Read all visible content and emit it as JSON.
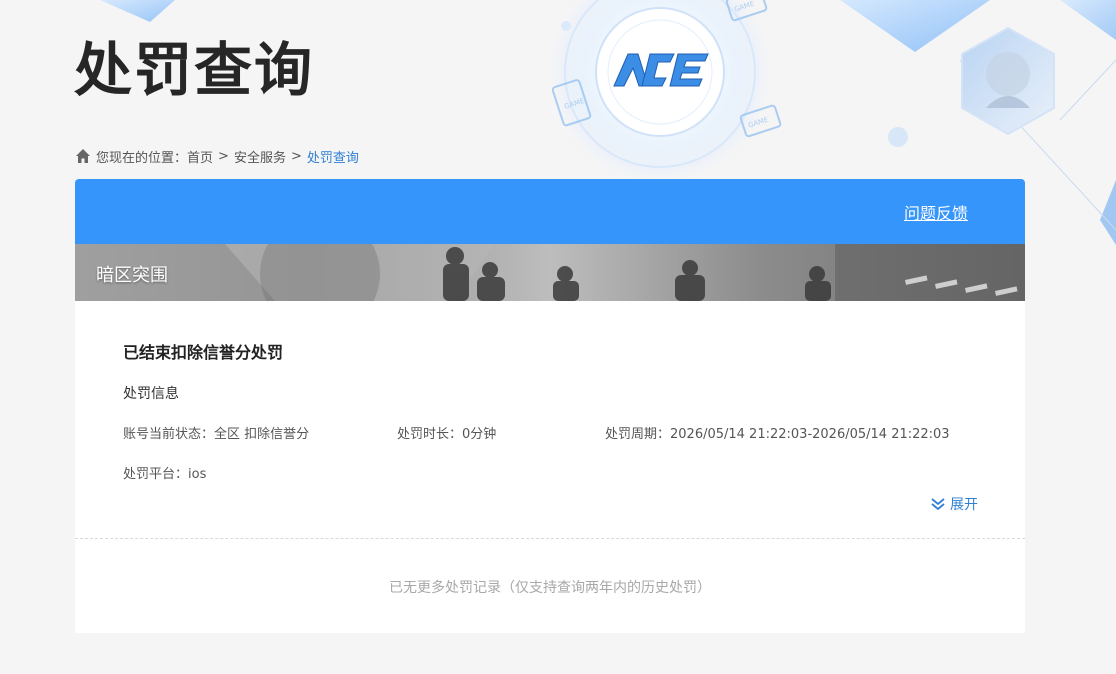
{
  "header": {
    "title": "处罚查询",
    "logo_text": "ACE",
    "game_badge": "GAME"
  },
  "breadcrumb": {
    "prefix": "您现在的位置：",
    "home": "首页",
    "separator": ">",
    "section": "安全服务",
    "current": "处罚查询"
  },
  "panel": {
    "feedback_label": "问题反馈",
    "game_name": "暗区突围"
  },
  "record": {
    "title": "已结束扣除信誉分处罚",
    "section_label": "处罚信息",
    "account_status": "账号当前状态：全区 扣除信誉分",
    "duration": "处罚时长：0分钟",
    "period": "处罚周期：2026/05/14 21:22:03-2026/05/14 21:22:03",
    "platform": "处罚平台：ios",
    "expand_label": "展开"
  },
  "footer": {
    "note": "已无更多处罚记录（仅支持查询两年内的历史处罚）"
  },
  "colors": {
    "accent_blue": "#3595fb",
    "link_blue": "#2f7fd4",
    "page_bg": "#f5f5f6"
  }
}
